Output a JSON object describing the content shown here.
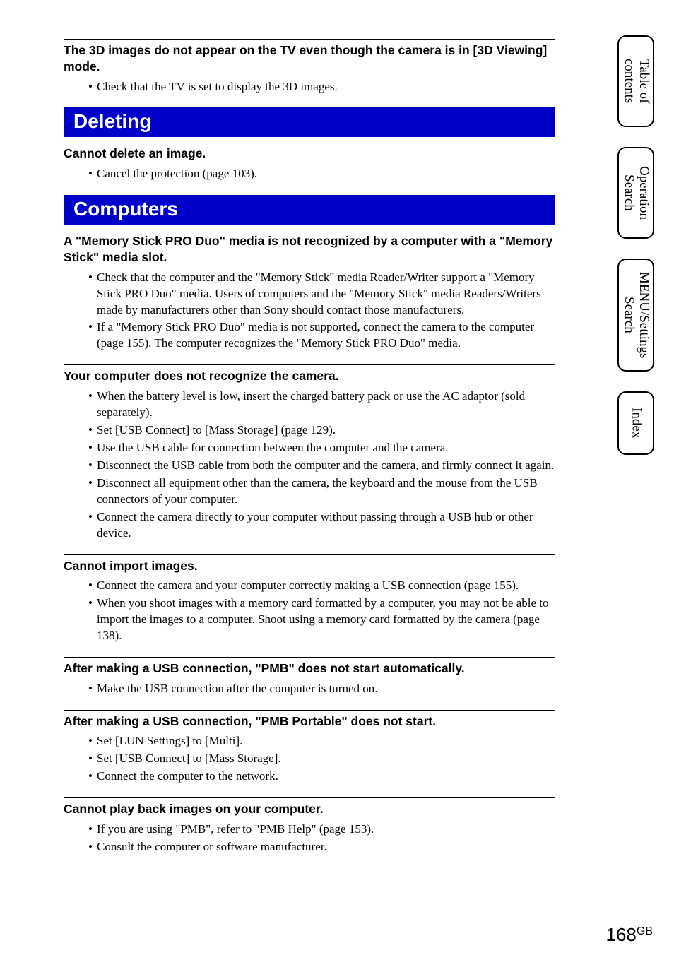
{
  "tabs": {
    "toc": "Table of contents",
    "operation": "Operation Search",
    "menu": "MENU/Settings Search",
    "index": "Index"
  },
  "sections": [
    {
      "heading": "The 3D images do not appear on the TV even though the camera is in [3D Viewing] mode.",
      "border": true,
      "items": [
        "Check that the TV is set to display the 3D images."
      ]
    }
  ],
  "blue1": "Deleting",
  "deleting": [
    {
      "heading": "Cannot delete an image.",
      "border": false,
      "items": [
        "Cancel the protection (page 103)."
      ]
    }
  ],
  "blue2": "Computers",
  "computers": [
    {
      "heading": "A \"Memory Stick PRO Duo\" media is not recognized by a computer with a \"Memory Stick\" media slot.",
      "border": false,
      "items": [
        "Check that the computer and the \"Memory Stick\" media Reader/Writer support a \"Memory Stick PRO Duo\" media. Users of computers and the \"Memory Stick\" media Readers/Writers made by manufacturers other than Sony should contact those manufacturers.",
        "If a \"Memory Stick PRO Duo\" media is not supported, connect the camera to the computer (page 155). The computer recognizes the \"Memory Stick PRO Duo\" media."
      ]
    },
    {
      "heading": "Your computer does not recognize the camera.",
      "border": true,
      "items": [
        "When the battery level is low, insert the charged battery pack or use the AC adaptor (sold separately).",
        "Set [USB Connect] to [Mass Storage] (page 129).",
        "Use the USB cable for connection between the computer and the camera.",
        "Disconnect the USB cable from both the computer and the camera, and firmly connect it again.",
        "Disconnect all equipment other than the camera, the keyboard and the mouse from the USB connectors of your computer.",
        "Connect the camera directly to your computer without passing through a USB hub or other device."
      ]
    },
    {
      "heading": "Cannot import images.",
      "border": true,
      "items": [
        "Connect the camera and your computer correctly making a USB connection (page 155).",
        "When you shoot images with a memory card formatted by a computer, you may not be able to import the images to a computer. Shoot using a memory card formatted by the camera (page 138)."
      ]
    },
    {
      "heading": "After making a USB connection, \"PMB\" does not start automatically.",
      "border": true,
      "items": [
        "Make the USB connection after the computer is turned on."
      ]
    },
    {
      "heading": "After making a USB connection, \"PMB Portable\" does not start.",
      "border": true,
      "items": [
        "Set [LUN Settings] to [Multi].",
        "Set [USB Connect] to [Mass Storage].",
        "Connect the computer to the network."
      ]
    },
    {
      "heading": "Cannot play back images on your computer.",
      "border": true,
      "items": [
        "If you are using \"PMB\", refer to \"PMB Help\" (page 153).",
        "Consult the computer or software manufacturer."
      ]
    }
  ],
  "page_number": "168",
  "page_suffix": "GB"
}
